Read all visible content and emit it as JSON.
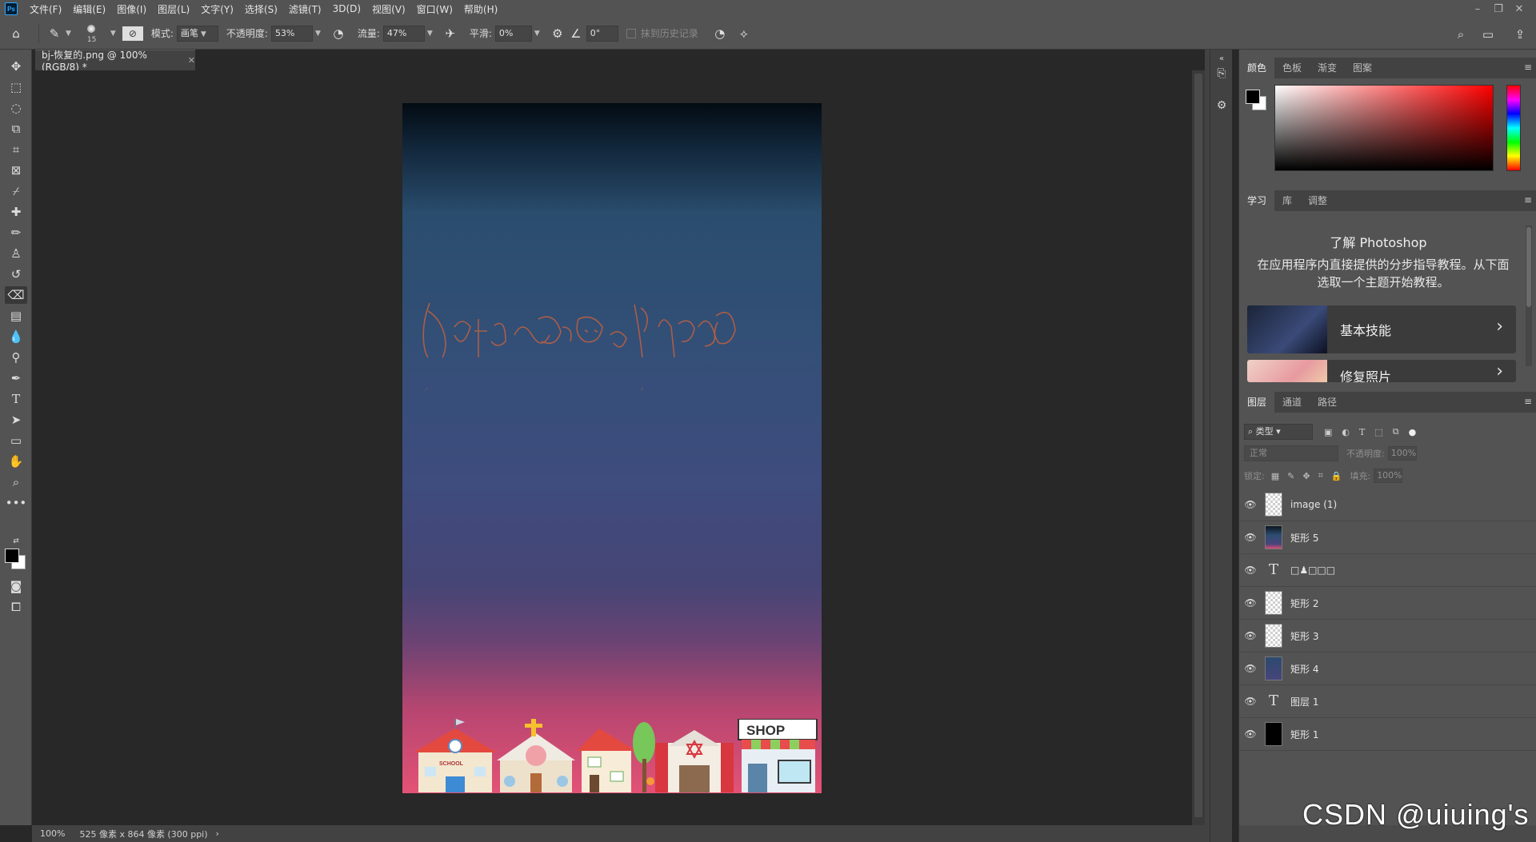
{
  "app": {
    "logo": "Ps",
    "menus": [
      "文件(F)",
      "编辑(E)",
      "图像(I)",
      "图层(L)",
      "文字(Y)",
      "选择(S)",
      "滤镜(T)",
      "3D(D)",
      "视图(V)",
      "窗口(W)",
      "帮助(H)"
    ],
    "window_controls": [
      "minimize-icon",
      "restore-icon",
      "close-icon"
    ]
  },
  "options": {
    "brush_size": "15",
    "mode_label": "模式:",
    "mode_value": "画笔",
    "opacity_label": "不透明度:",
    "opacity_value": "53%",
    "flow_label": "流量:",
    "flow_value": "47%",
    "smoothing_label": "平滑:",
    "smoothing_value": "0%",
    "angle_value": "0°",
    "erase_history_label": "抹到历史记录"
  },
  "document": {
    "tab_title": "bj-恢复的.png @ 100%(RGB/8) *",
    "zoom": "100%",
    "size_info": "525 像素 x 864 像素 (300 ppi)",
    "shop_sign": "SHOP",
    "school_sign": "SCHOOL"
  },
  "color_panel": {
    "tabs": [
      "颜色",
      "色板",
      "渐变",
      "图案"
    ],
    "fg_color": "#000000",
    "bg_color": "#ffffff"
  },
  "learn_panel": {
    "tabs": [
      "学习",
      "库",
      "调整"
    ],
    "title": "了解 Photoshop",
    "description": "在应用程序内直接提供的分步指导教程。从下面选取一个主题开始教程。",
    "cards": [
      "基本技能",
      "修复照片"
    ]
  },
  "layers_panel": {
    "tabs": [
      "图层",
      "通道",
      "路径"
    ],
    "filter_label": "类型",
    "blend_mode": "正常",
    "opacity_label": "不透明度:",
    "opacity_value": "100%",
    "lock_label": "锁定:",
    "fill_label": "填充:",
    "fill_value": "100%",
    "layers": [
      {
        "name": "image (1)",
        "kind": "image"
      },
      {
        "name": "矩形 5",
        "kind": "shape"
      },
      {
        "name": "□♟□□□",
        "kind": "text"
      },
      {
        "name": "矩形 2",
        "kind": "shape"
      },
      {
        "name": "矩形 3",
        "kind": "shape"
      },
      {
        "name": "矩形 4",
        "kind": "shape"
      },
      {
        "name": "图层 1",
        "kind": "text"
      },
      {
        "name": "矩形 1",
        "kind": "shape"
      }
    ]
  },
  "watermark": "CSDN @uiuing's"
}
